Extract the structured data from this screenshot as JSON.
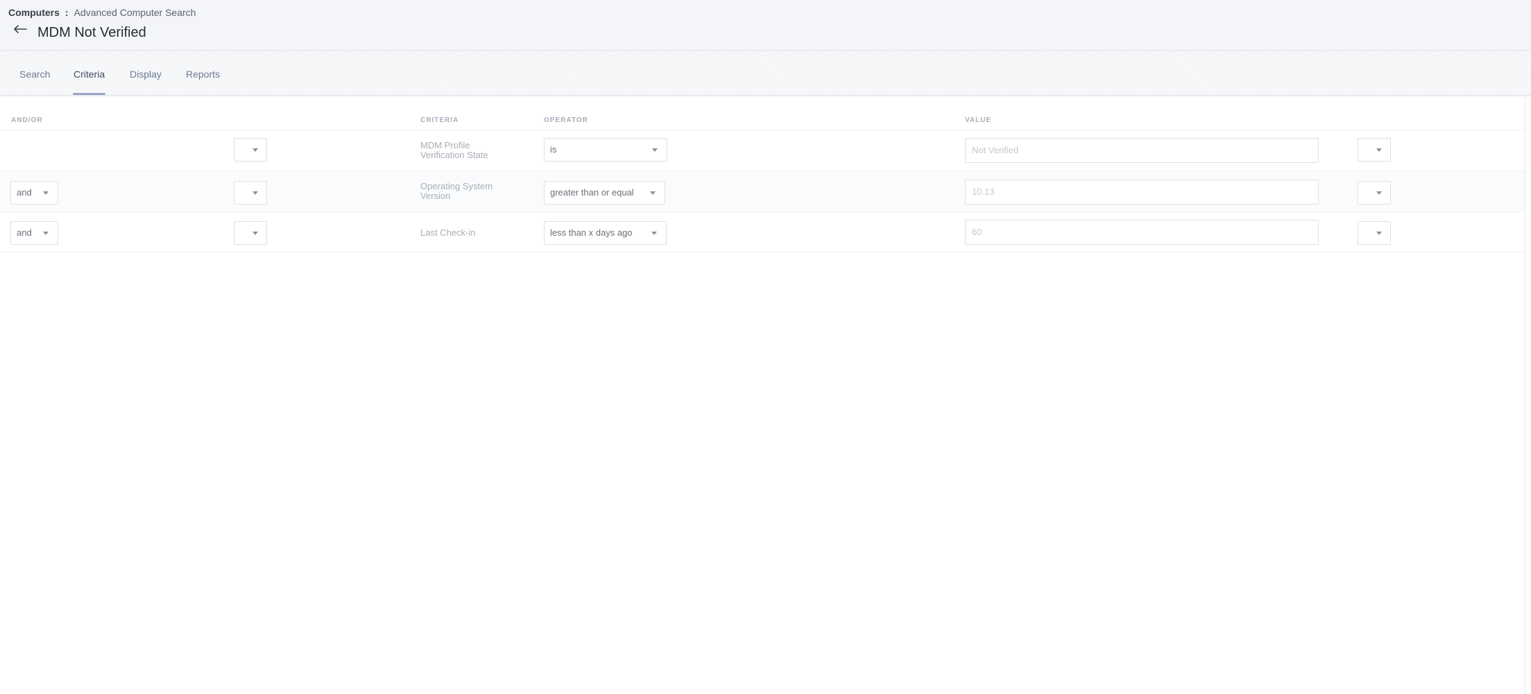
{
  "header": {
    "breadcrumb_root": "Computers",
    "breadcrumb_sep": ":",
    "breadcrumb_current": "Advanced Computer Search",
    "title": "MDM Not Verified",
    "back_icon": "arrow-left-icon"
  },
  "tabs": [
    {
      "label": "Search",
      "active": false
    },
    {
      "label": "Criteria",
      "active": true
    },
    {
      "label": "Display",
      "active": false
    },
    {
      "label": "Reports",
      "active": false
    }
  ],
  "columns": {
    "andor": "AND/OR",
    "criteria": "CRITERIA",
    "operator": "OPERATOR",
    "value": "VALUE"
  },
  "rows": [
    {
      "andor": "",
      "paren_open": "",
      "criteria_line1": "MDM Profile",
      "criteria_line2": "Verification State",
      "operator": "is",
      "value": "Not Verified",
      "paren_close": ""
    },
    {
      "andor": "and",
      "paren_open": "",
      "criteria_line1": "Operating System",
      "criteria_line2": "Version",
      "operator": "greater than or equal",
      "value": "10.13",
      "paren_close": ""
    },
    {
      "andor": "and",
      "paren_open": "",
      "criteria_line1": "Last Check-in",
      "criteria_line2": "",
      "operator": "less than x days ago",
      "value": "60",
      "paren_close": ""
    }
  ],
  "colors": {
    "header_bg": "#f4f5f9",
    "active_tab_underline": "#9aa7c6",
    "tab_text": "#6b7a94"
  }
}
